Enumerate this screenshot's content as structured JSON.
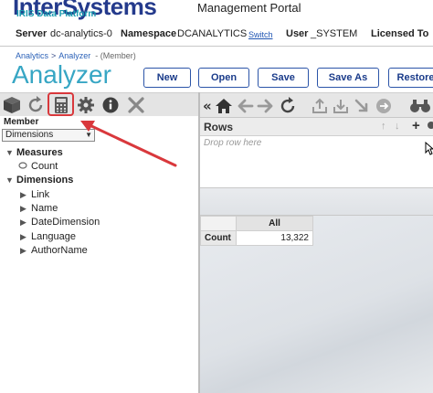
{
  "header": {
    "logo_main": "InterSystems",
    "logo_sub": "IRIS Data Platform",
    "portal_title": "Management Portal",
    "server_label": "Server",
    "server_value": "dc-analytics-0",
    "namespace_label": "Namespace",
    "namespace_value": "DCANALYTICS",
    "switch_link": "Switch",
    "user_label": "User",
    "user_value": "_SYSTEM",
    "licensed_label": "Licensed To"
  },
  "breadcrumb": {
    "items": [
      "Analytics",
      "Analyzer"
    ],
    "separator": ">",
    "member": "- (Member)"
  },
  "page_title": "Analyzer",
  "toolbar": {
    "new_label": "New",
    "open_label": "Open",
    "save_label": "Save",
    "save_as_label": "Save As",
    "restore_label": "Restore"
  },
  "left_panel": {
    "icons": [
      "cube-icon",
      "refresh-icon",
      "calculator-icon",
      "gear-icon",
      "info-icon",
      "close-icon"
    ],
    "member_label": "Member",
    "dimension_select": "Dimensions",
    "tree": {
      "measures_label": "Measures",
      "measure_items": [
        "Count"
      ],
      "dimensions_label": "Dimensions",
      "dimension_items": [
        "Link",
        "Name",
        "DateDimension",
        "Language",
        "AuthorName"
      ]
    }
  },
  "right_panel": {
    "icons": [
      "collapse-icon",
      "home-icon",
      "back-icon",
      "forward-icon",
      "refresh-icon",
      "export-icon",
      "import-icon",
      "download-icon",
      "toggle-icon",
      "binoculars-icon"
    ],
    "rows_label": "Rows",
    "rows_drop_hint": "Drop row here",
    "pivot": {
      "column_header": "All",
      "row_header": "Count",
      "value": "13,322"
    }
  },
  "colors": {
    "brand_blue": "#243a8c",
    "accent_teal": "#37a6c4",
    "highlight_red": "#d9383c"
  }
}
